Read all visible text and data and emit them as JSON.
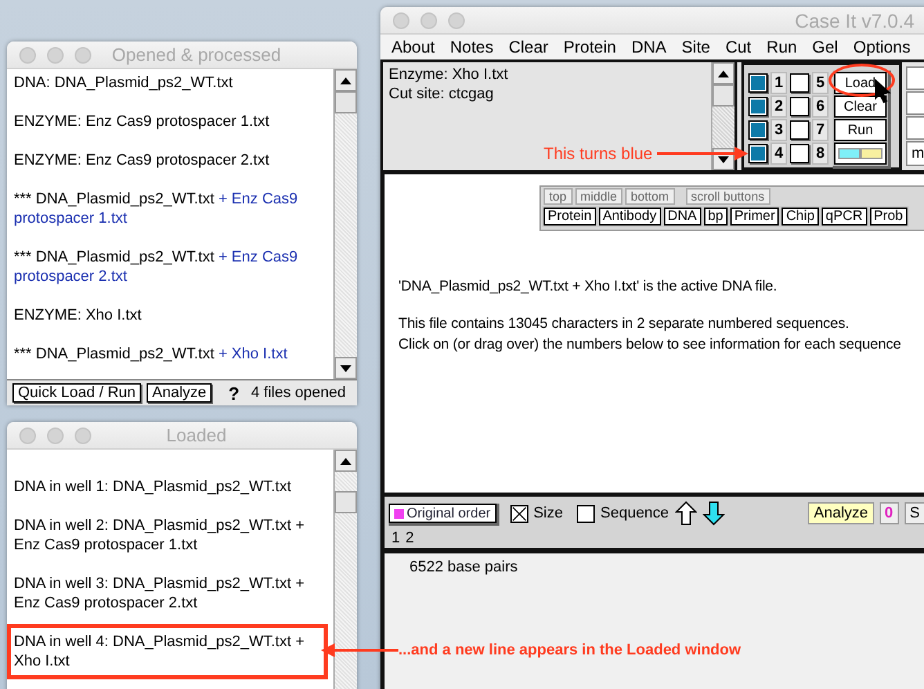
{
  "opened_window": {
    "title": "Opened & processed",
    "entries": [
      {
        "kind": "plain",
        "text": "DNA: DNA_Plasmid_ps2_WT.txt"
      },
      {
        "kind": "plain",
        "text": "ENZYME: Enz Cas9 protospacer 1.txt"
      },
      {
        "kind": "plain",
        "text": "ENZYME: Enz Cas9 protospacer 2.txt"
      },
      {
        "kind": "combo",
        "text": "*** DNA_Plasmid_ps2_WT.txt",
        "added": "+ Enz Cas9 protospacer 1.txt"
      },
      {
        "kind": "combo",
        "text": "*** DNA_Plasmid_ps2_WT.txt",
        "added": "+ Enz Cas9 protospacer 2.txt"
      },
      {
        "kind": "plain",
        "text": "ENZYME: Xho I.txt"
      },
      {
        "kind": "combo",
        "text": "*** DNA_Plasmid_ps2_WT.txt",
        "added": "+ Xho I.txt"
      }
    ],
    "buttons": [
      "Quick Load / Run",
      "Analyze"
    ],
    "help": "?",
    "status": "4  files opened"
  },
  "loaded_window": {
    "title": "Loaded",
    "entries": [
      {
        "text": "DNA in well 1:  DNA_Plasmid_ps2_WT.txt",
        "highlighted": false
      },
      {
        "text": "DNA in well 2:  DNA_Plasmid_ps2_WT.txt + Enz Cas9 protospacer 1.txt",
        "highlighted": false
      },
      {
        "text": "DNA in well 3:  DNA_Plasmid_ps2_WT.txt + Enz Cas9 protospacer 2.txt",
        "highlighted": false
      },
      {
        "text": "DNA in well 4:  DNA_Plasmid_ps2_WT.txt + Xho I.txt",
        "highlighted": true
      }
    ]
  },
  "main_window": {
    "title": "Case It v7.0.4",
    "menu": [
      "About",
      "Notes",
      "Clear",
      "Protein",
      "DNA",
      "Site",
      "Cut",
      "Run",
      "Gel",
      "Options"
    ],
    "info": [
      "Enzyme: Xho I.txt",
      "Cut site: ctcgag"
    ],
    "wells": [
      {
        "number": "1",
        "checked": true
      },
      {
        "number": "2",
        "checked": true
      },
      {
        "number": "3",
        "checked": true
      },
      {
        "number": "4",
        "checked": true
      },
      {
        "number": "5",
        "checked": false
      },
      {
        "number": "6",
        "checked": false
      },
      {
        "number": "7",
        "checked": false
      },
      {
        "number": "8",
        "checked": false
      }
    ],
    "side_buttons": [
      {
        "kind": "text",
        "label": "Load",
        "circled": true
      },
      {
        "kind": "text",
        "label": "Clear",
        "circled": false
      },
      {
        "kind": "text",
        "label": "Run",
        "circled": false
      },
      {
        "kind": "swatch",
        "circled": false
      }
    ],
    "right_field": "m",
    "view_tabs": [
      "top",
      "middle",
      "bottom"
    ],
    "scroll_tab": "scroll buttons",
    "tools": [
      "Protein",
      "Antibody",
      "DNA",
      "bp",
      "Primer",
      "Chip",
      "qPCR",
      "Prob"
    ],
    "messages": [
      "'DNA_Plasmid_ps2_WT.txt + Xho I.txt' is the active DNA file.",
      "This file contains 13045 characters in 2 separate numbered sequences.",
      "Click on (or drag over) the numbers below to see information for each sequence"
    ],
    "sort_button": "Original order",
    "options": [
      {
        "label": "Size",
        "checked": true
      },
      {
        "label": "Sequence",
        "checked": false
      }
    ],
    "analyze": "Analyze",
    "zero": "0",
    "cut_button": "S",
    "sequence_numbers": [
      "1",
      "2"
    ],
    "result": "6522 base pairs"
  },
  "annotations": [
    {
      "kind": "well",
      "text": "This turns blue"
    },
    {
      "kind": "loaded",
      "text": "...and a new line appears in the Loaded window"
    }
  ]
}
